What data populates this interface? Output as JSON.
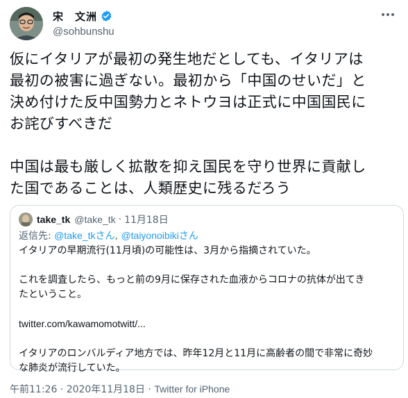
{
  "author": {
    "display_name": "宋　文洲",
    "handle": "@sohbunshu",
    "verified": true,
    "verified_color": "#1d9bf0"
  },
  "tweet": {
    "text_lines": [
      "仮にイタリアが最初の発生地だとしても、イタリアは",
      "最初の被害に過ぎない。最初から「中国のせいだ」と",
      "決め付けた反中国勢力とネトウヨは正式に中国国民に",
      "お詫びすべきだ",
      "",
      "中国は最も厳しく拡散を抑え国民を守り世界に貢献し",
      "た国であることは、人類歴史に残るだろう"
    ],
    "timestamp": "午前11:26 · 2020年11月18日",
    "separator": " · ",
    "source": "Twitter for iPhone"
  },
  "quoted_tweet": {
    "display_name": "take_tk",
    "handle": "@take_tk",
    "separator": "·",
    "date": "11月18日",
    "reply_prefix": "返信先: ",
    "reply_to_1": "@take_tkさん",
    "reply_joiner": ", ",
    "reply_to_2": "@taiyonoibikiさん",
    "body_1": "イタリアの早期流行(11月頃)の可能性は、3月から指摘されていた。",
    "body_2": "これを調査したら、もっと前の9月に保存された血液からコロナの抗体が出てき\nたということ。",
    "body_url": "twitter.com/kawamomotwitt/...",
    "body_3": "イタリアのロンバルディア地方では、昨年12月と11月に高齢者の間で非常に奇妙\nな肺炎が流行していた。"
  },
  "colors": {
    "text": "#0f1419",
    "secondary": "#536471",
    "link": "#1d9bf0",
    "border": "#cfd9de"
  }
}
